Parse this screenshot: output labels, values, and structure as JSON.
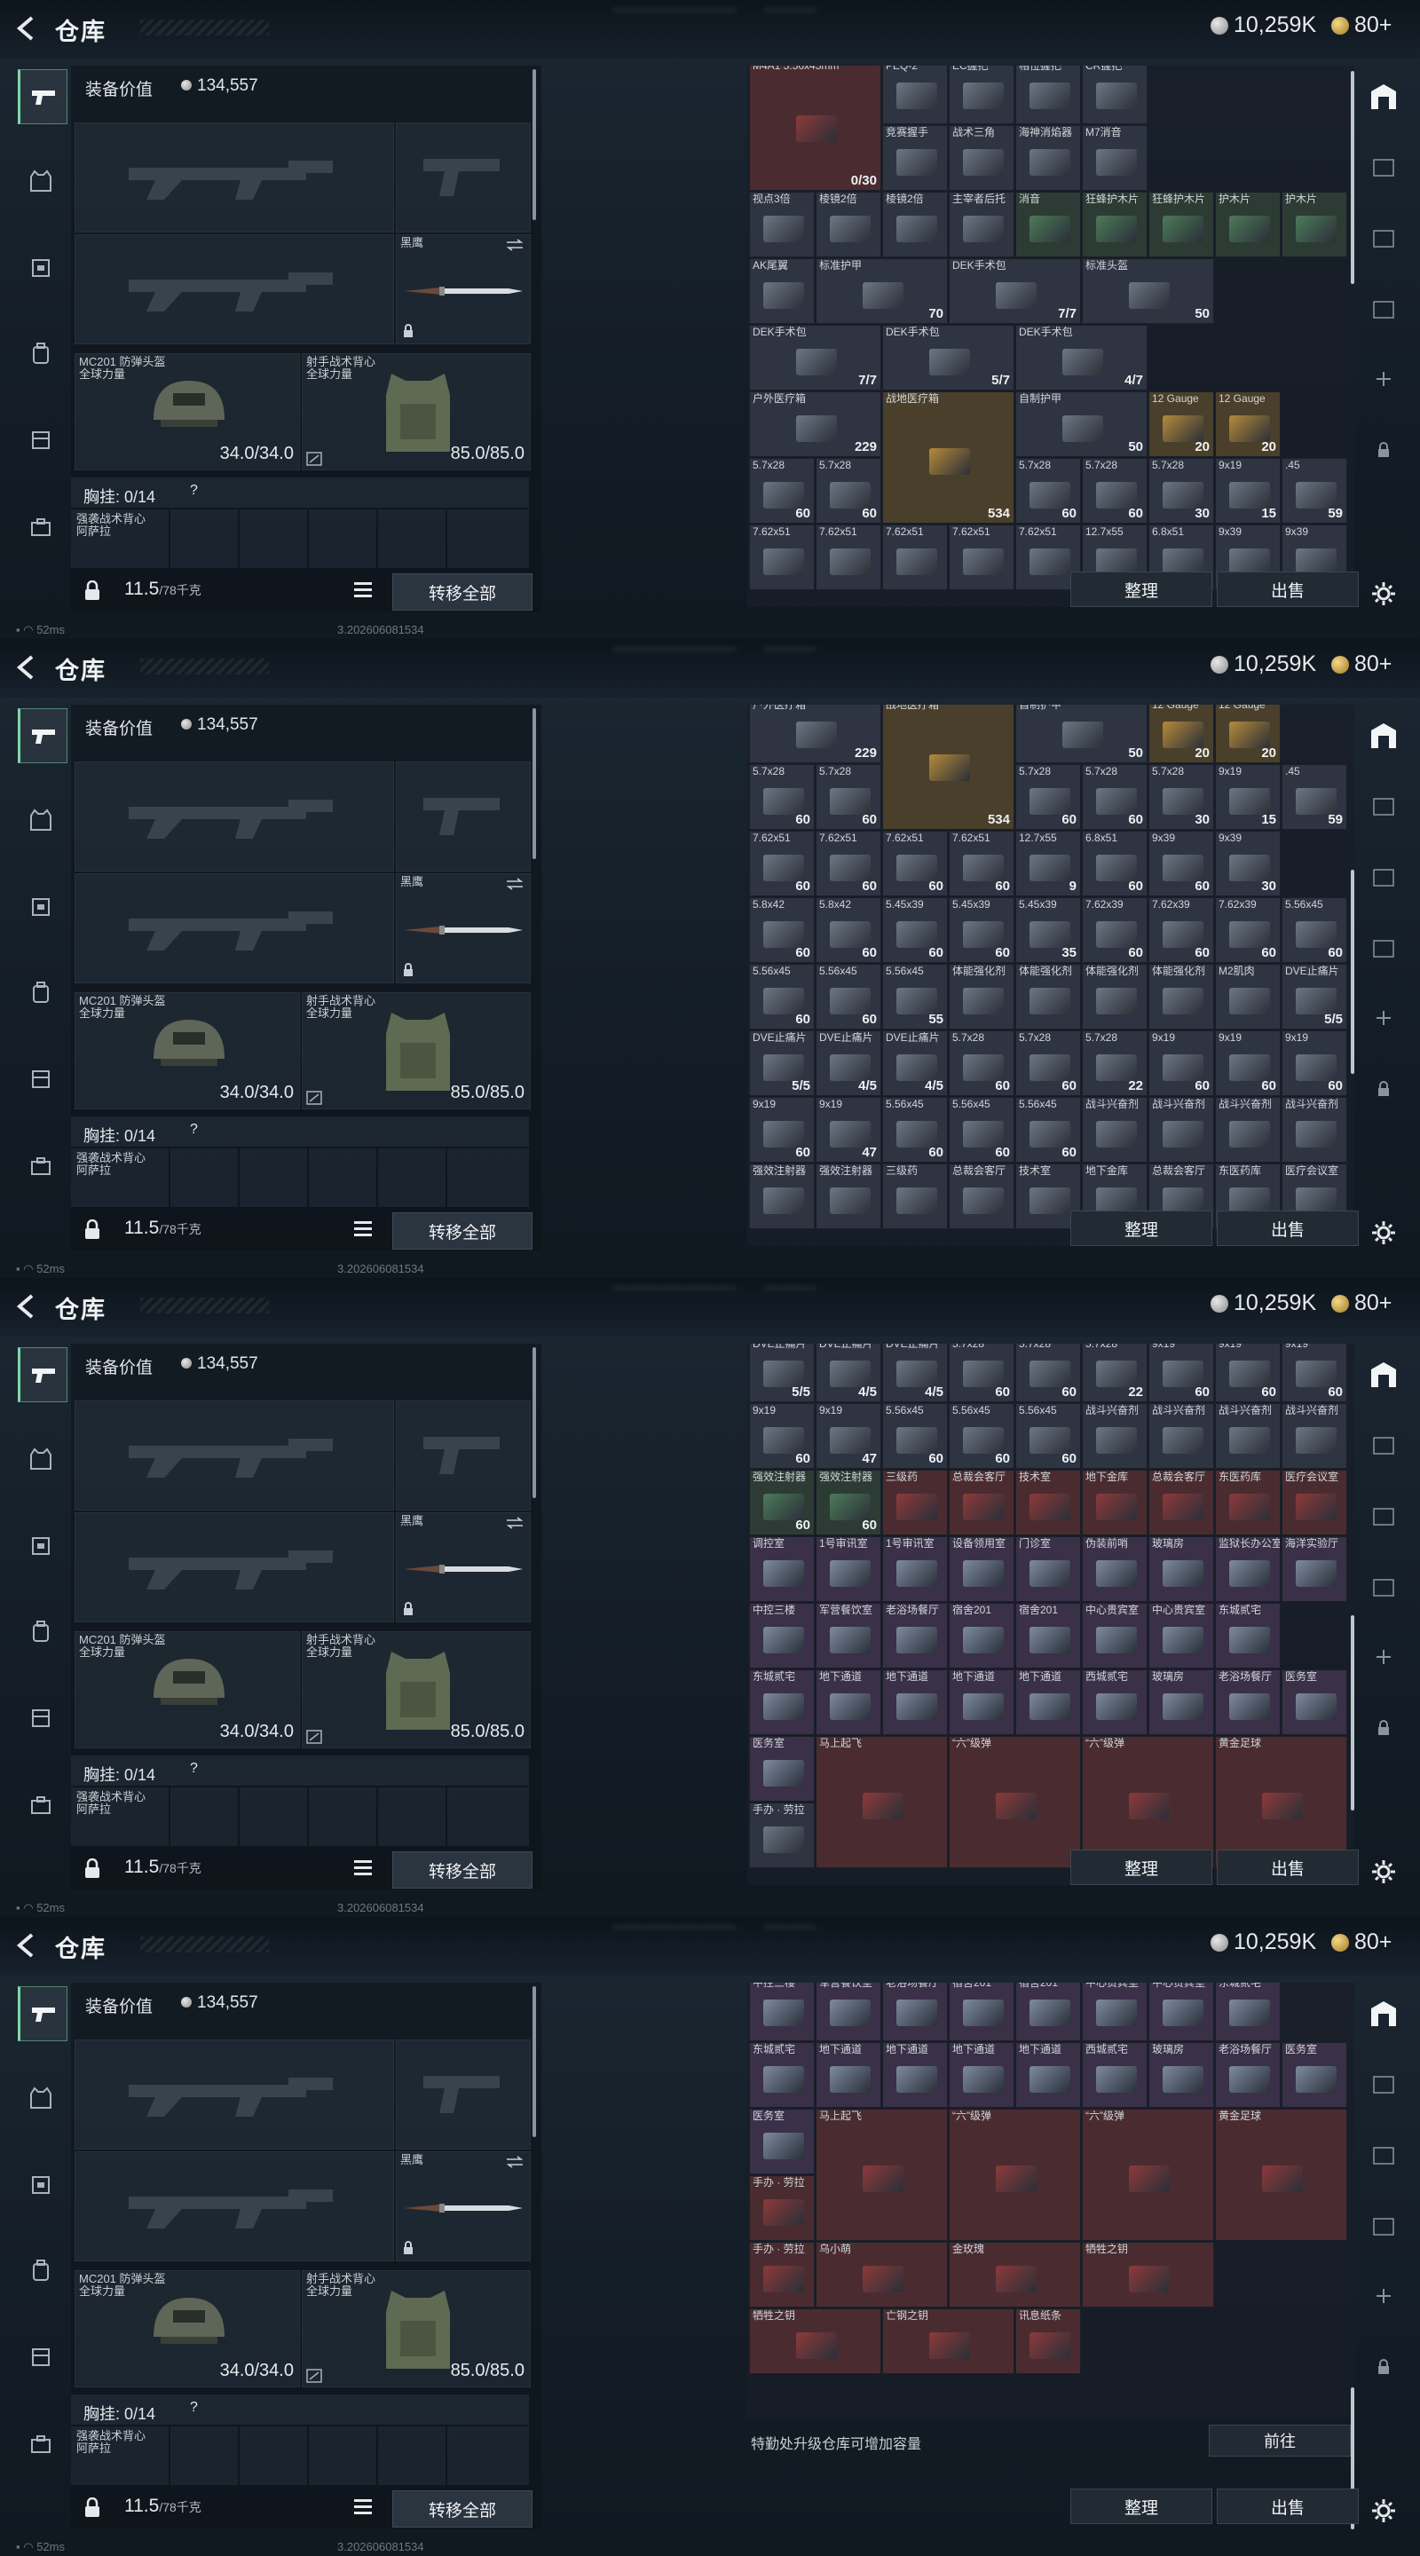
{
  "header": {
    "title": "仓库",
    "currency_silver": "10,259K",
    "currency_gold": "80+"
  },
  "gear": {
    "value_label": "装备价值",
    "value": "134,557",
    "knife_label": "黑鹰",
    "helmet": {
      "name": "MC201 防弹头盔",
      "sub": "全球力量",
      "durability": "34.0/34.0"
    },
    "vest": {
      "name": "射手战术背心",
      "sub": "全球力量",
      "durability": "85.0/85.0"
    },
    "chest_label": "胸挂: 0/14",
    "rig_label": "强袭战术背心 阿萨拉",
    "weight": "11.5",
    "weight_max": "/78千克",
    "transfer_btn": "转移全部"
  },
  "stash": {
    "sort_btn": "整理",
    "sell_btn": "出售",
    "upgrade_text": "特勤处升级仓库可增加容量",
    "goto_btn": "前往"
  },
  "status": {
    "ping": "52ms",
    "version": "3.202606081534"
  },
  "colors": {
    "accent": "#7fd8a6",
    "red_item": "#4a2c30",
    "gold_item": "#4a3f2a"
  },
  "panes": [
    {
      "rows": [
        [
          {
            "n": "M4A1 5.56x45mm",
            "q": "0/30",
            "c": "red",
            "w": 2,
            "h": 2
          },
          {
            "n": "PEQ-2"
          },
          {
            "n": "EC握把"
          },
          {
            "n": "相位握把"
          },
          {
            "n": "CR握把"
          }
        ],
        [
          {
            "n": "竞赛握手"
          },
          {
            "n": "战术三角"
          },
          {
            "n": "海神消焰器"
          },
          {
            "n": "M7消音"
          }
        ],
        [
          {
            "n": "视点3倍"
          },
          {
            "n": "棱镜2倍"
          },
          {
            "n": "棱镜2倍"
          },
          {
            "n": "主宰者后托"
          },
          {
            "n": "消音",
            "c": "green"
          },
          {
            "n": "狂蜂护木片",
            "c": "green"
          },
          {
            "n": "狂蜂护木片",
            "c": "green"
          },
          {
            "n": "护木片",
            "c": "green"
          },
          {
            "n": "护木片",
            "c": "green"
          }
        ],
        [
          {
            "n": "AK尾翼"
          },
          {
            "n": "标准护甲",
            "q": "70",
            "w": 2
          },
          {
            "n": "DEK手术包",
            "q": "7/7",
            "w": 2
          },
          {
            "n": "标准头盔",
            "q": "50",
            "w": 2
          }
        ],
        [
          {
            "n": "DEK手术包",
            "q": "7/7",
            "w": 2
          },
          {
            "n": "DEK手术包",
            "q": "5/7",
            "w": 2
          },
          {
            "n": "DEK手术包",
            "q": "4/7",
            "w": 2
          }
        ],
        [
          {
            "n": "户外医疗箱",
            "q": "229",
            "w": 2
          },
          {
            "n": "战地医疗箱",
            "q": "534",
            "c": "gold",
            "w": 2,
            "h": 2
          },
          {
            "n": "自制护甲",
            "q": "50",
            "w": 2
          },
          {
            "n": "12 Gauge",
            "q": "20",
            "c": "gold"
          },
          {
            "n": "12 Gauge",
            "q": "20",
            "c": "gold"
          }
        ],
        [
          {
            "n": "5.7x28",
            "q": "60"
          },
          {
            "n": "5.7x28",
            "q": "60"
          },
          {
            "n": "5.7x28",
            "q": "60"
          },
          {
            "n": "5.7x28",
            "q": "60"
          },
          {
            "n": "5.7x28",
            "q": "30"
          },
          {
            "n": "9x19",
            "q": "15"
          },
          {
            "n": ".45",
            "q": "59"
          }
        ],
        [
          {
            "n": "7.62x51"
          },
          {
            "n": "7.62x51"
          },
          {
            "n": "7.62x51"
          },
          {
            "n": "7.62x51"
          },
          {
            "n": "7.62x51"
          },
          {
            "n": "12.7x55"
          },
          {
            "n": "6.8x51"
          },
          {
            "n": "9x39"
          },
          {
            "n": "9x39"
          }
        ]
      ]
    },
    {
      "rows": [
        [
          {
            "n": "户外医疗箱",
            "q": "229",
            "w": 2
          },
          {
            "n": "战地医疗箱",
            "q": "534",
            "c": "gold",
            "w": 2,
            "h": 2
          },
          {
            "n": "自制护甲",
            "q": "50",
            "w": 2
          },
          {
            "n": "12 Gauge",
            "q": "20",
            "c": "gold"
          },
          {
            "n": "12 Gauge",
            "q": "20",
            "c": "gold"
          }
        ],
        [
          {
            "n": "5.7x28",
            "q": "60"
          },
          {
            "n": "5.7x28",
            "q": "60"
          },
          {
            "n": "5.7x28",
            "q": "60"
          },
          {
            "n": "5.7x28",
            "q": "60"
          },
          {
            "n": "5.7x28",
            "q": "30"
          },
          {
            "n": "9x19",
            "q": "15"
          },
          {
            "n": ".45",
            "q": "59"
          }
        ],
        [
          {
            "n": "7.62x51",
            "q": "60"
          },
          {
            "n": "7.62x51",
            "q": "60"
          },
          {
            "n": "7.62x51",
            "q": "60"
          },
          {
            "n": "7.62x51",
            "q": "60"
          },
          {
            "n": "12.7x55",
            "q": "9"
          },
          {
            "n": "6.8x51",
            "q": "60"
          },
          {
            "n": "9x39",
            "q": "60"
          },
          {
            "n": "9x39",
            "q": "30"
          }
        ],
        [
          {
            "n": "5.8x42",
            "q": "60"
          },
          {
            "n": "5.8x42",
            "q": "60"
          },
          {
            "n": "5.45x39",
            "q": "60"
          },
          {
            "n": "5.45x39",
            "q": "60"
          },
          {
            "n": "5.45x39",
            "q": "35"
          },
          {
            "n": "7.62x39",
            "q": "60"
          },
          {
            "n": "7.62x39",
            "q": "60"
          },
          {
            "n": "7.62x39",
            "q": "60"
          },
          {
            "n": "5.56x45",
            "q": "60"
          }
        ],
        [
          {
            "n": "5.56x45",
            "q": "60"
          },
          {
            "n": "5.56x45",
            "q": "60"
          },
          {
            "n": "5.56x45",
            "q": "55"
          },
          {
            "n": "体能强化剂"
          },
          {
            "n": "体能强化剂"
          },
          {
            "n": "体能强化剂"
          },
          {
            "n": "体能强化剂"
          },
          {
            "n": "M2肌肉"
          },
          {
            "n": "DVE止痛片",
            "q": "5/5"
          }
        ],
        [
          {
            "n": "DVE止痛片",
            "q": "5/5"
          },
          {
            "n": "DVE止痛片",
            "q": "4/5"
          },
          {
            "n": "DVE止痛片",
            "q": "4/5"
          },
          {
            "n": "5.7x28",
            "q": "60"
          },
          {
            "n": "5.7x28",
            "q": "60"
          },
          {
            "n": "5.7x28",
            "q": "22"
          },
          {
            "n": "9x19",
            "q": "60"
          },
          {
            "n": "9x19",
            "q": "60"
          },
          {
            "n": "9x19",
            "q": "60"
          }
        ],
        [
          {
            "n": "9x19",
            "q": "60"
          },
          {
            "n": "9x19",
            "q": "47"
          },
          {
            "n": "5.56x45",
            "q": "60"
          },
          {
            "n": "5.56x45",
            "q": "60"
          },
          {
            "n": "5.56x45",
            "q": "60"
          },
          {
            "n": "战斗兴奋剂"
          },
          {
            "n": "战斗兴奋剂"
          },
          {
            "n": "战斗兴奋剂"
          },
          {
            "n": "战斗兴奋剂"
          }
        ],
        [
          {
            "n": "强效注射器"
          },
          {
            "n": "强效注射器"
          },
          {
            "n": "三级药"
          },
          {
            "n": "总裁会客厅"
          },
          {
            "n": "技术室"
          },
          {
            "n": "地下金库"
          },
          {
            "n": "总裁会客厅"
          },
          {
            "n": "东医药库"
          },
          {
            "n": "医疗会议室"
          }
        ]
      ]
    },
    {
      "rows": [
        [
          {
            "n": "DVE止痛片",
            "q": "5/5"
          },
          {
            "n": "DVE止痛片",
            "q": "4/5"
          },
          {
            "n": "DVE止痛片",
            "q": "4/5"
          },
          {
            "n": "5.7x28",
            "q": "60"
          },
          {
            "n": "5.7x28",
            "q": "60"
          },
          {
            "n": "5.7x28",
            "q": "22"
          },
          {
            "n": "9x19",
            "q": "60"
          },
          {
            "n": "9x19",
            "q": "60"
          },
          {
            "n": "9x19",
            "q": "60"
          }
        ],
        [
          {
            "n": "9x19",
            "q": "60"
          },
          {
            "n": "9x19",
            "q": "47"
          },
          {
            "n": "5.56x45",
            "q": "60"
          },
          {
            "n": "5.56x45",
            "q": "60"
          },
          {
            "n": "5.56x45",
            "q": "60"
          },
          {
            "n": "战斗兴奋剂"
          },
          {
            "n": "战斗兴奋剂"
          },
          {
            "n": "战斗兴奋剂"
          },
          {
            "n": "战斗兴奋剂"
          }
        ],
        [
          {
            "n": "强效注射器",
            "q": "60",
            "c": "green"
          },
          {
            "n": "强效注射器",
            "q": "60",
            "c": "green"
          },
          {
            "n": "三级药",
            "c": "red"
          },
          {
            "n": "总裁会客厅",
            "c": "red"
          },
          {
            "n": "技术室",
            "c": "red"
          },
          {
            "n": "地下金库",
            "c": "red"
          },
          {
            "n": "总裁会客厅",
            "c": "red"
          },
          {
            "n": "东医药库",
            "c": "red"
          },
          {
            "n": "医疗会议室",
            "c": "red"
          }
        ],
        [
          {
            "n": "调控室",
            "c": "purple"
          },
          {
            "n": "1号审讯室",
            "c": "purple"
          },
          {
            "n": "1号审讯室",
            "c": "purple"
          },
          {
            "n": "设备领用室",
            "c": "purple"
          },
          {
            "n": "门诊室",
            "c": "purple"
          },
          {
            "n": "伪装前哨",
            "c": "purple"
          },
          {
            "n": "玻璃房",
            "c": "purple"
          },
          {
            "n": "监狱长办公室",
            "c": "purple"
          },
          {
            "n": "海洋实验厅",
            "c": "purple"
          }
        ],
        [
          {
            "n": "中控三楼",
            "c": "purple"
          },
          {
            "n": "军营餐饮室",
            "c": "purple"
          },
          {
            "n": "老浴场餐厅",
            "c": "purple"
          },
          {
            "n": "宿舍201",
            "c": "purple"
          },
          {
            "n": "宿舍201",
            "c": "purple"
          },
          {
            "n": "中心贵宾室",
            "c": "purple"
          },
          {
            "n": "中心贵宾室",
            "c": "purple"
          },
          {
            "n": "东城贰宅",
            "c": "purple"
          }
        ],
        [
          {
            "n": "东城贰宅",
            "c": "purple"
          },
          {
            "n": "地下通道",
            "c": "purple"
          },
          {
            "n": "地下通道",
            "c": "purple"
          },
          {
            "n": "地下通道",
            "c": "purple"
          },
          {
            "n": "地下通道",
            "c": "purple"
          },
          {
            "n": "西城贰宅",
            "c": "purple"
          },
          {
            "n": "玻璃房",
            "c": "purple"
          },
          {
            "n": "老浴场餐厅",
            "c": "purple"
          },
          {
            "n": "医务室",
            "c": "purple"
          }
        ],
        [
          {
            "n": "医务室",
            "c": "purple"
          },
          {
            "n": "马上起飞",
            "c": "red",
            "w": 2,
            "h": 2
          },
          {
            "n": "“六”级弹",
            "c": "red",
            "w": 2,
            "h": 2
          },
          {
            "n": "“六”级弹",
            "c": "red",
            "w": 2,
            "h": 2
          },
          {
            "n": "黄金足球",
            "c": "red",
            "w": 2,
            "h": 2
          }
        ],
        [
          {
            "n": "手办 · 劳拉"
          }
        ]
      ]
    },
    {
      "rows": [
        [
          {
            "n": "中控三楼",
            "c": "purple"
          },
          {
            "n": "军营餐饮室",
            "c": "purple"
          },
          {
            "n": "老浴场餐厅",
            "c": "purple"
          },
          {
            "n": "宿舍201",
            "c": "purple"
          },
          {
            "n": "宿舍201",
            "c": "purple"
          },
          {
            "n": "中心贵宾室",
            "c": "purple"
          },
          {
            "n": "中心贵宾室",
            "c": "purple"
          },
          {
            "n": "东城贰宅",
            "c": "purple"
          }
        ],
        [
          {
            "n": "东城贰宅",
            "c": "purple"
          },
          {
            "n": "地下通道",
            "c": "purple"
          },
          {
            "n": "地下通道",
            "c": "purple"
          },
          {
            "n": "地下通道",
            "c": "purple"
          },
          {
            "n": "地下通道",
            "c": "purple"
          },
          {
            "n": "西城贰宅",
            "c": "purple"
          },
          {
            "n": "玻璃房",
            "c": "purple"
          },
          {
            "n": "老浴场餐厅",
            "c": "purple"
          },
          {
            "n": "医务室",
            "c": "purple"
          }
        ],
        [
          {
            "n": "医务室",
            "c": "purple"
          },
          {
            "n": "马上起飞",
            "c": "red",
            "w": 2,
            "h": 2
          },
          {
            "n": "“六”级弹",
            "c": "red",
            "w": 2,
            "h": 2
          },
          {
            "n": "“六”级弹",
            "c": "red",
            "w": 2,
            "h": 2
          },
          {
            "n": "黄金足球",
            "c": "red",
            "w": 2,
            "h": 2
          }
        ],
        [
          {
            "n": "手办 · 劳拉",
            "c": "red"
          }
        ],
        [
          {
            "n": "手办 · 劳拉",
            "c": "red"
          },
          {
            "n": "乌小萌",
            "c": "red",
            "w": 2
          },
          {
            "n": "金玫瑰",
            "c": "red",
            "w": 2
          },
          {
            "n": "牺牲之钥",
            "c": "red",
            "w": 2
          }
        ],
        [
          {
            "n": "牺牲之钥",
            "c": "red",
            "w": 2
          },
          {
            "n": "亡钢之钥",
            "c": "red",
            "w": 2
          },
          {
            "n": "讯息纸条",
            "c": "red"
          }
        ]
      ]
    }
  ]
}
